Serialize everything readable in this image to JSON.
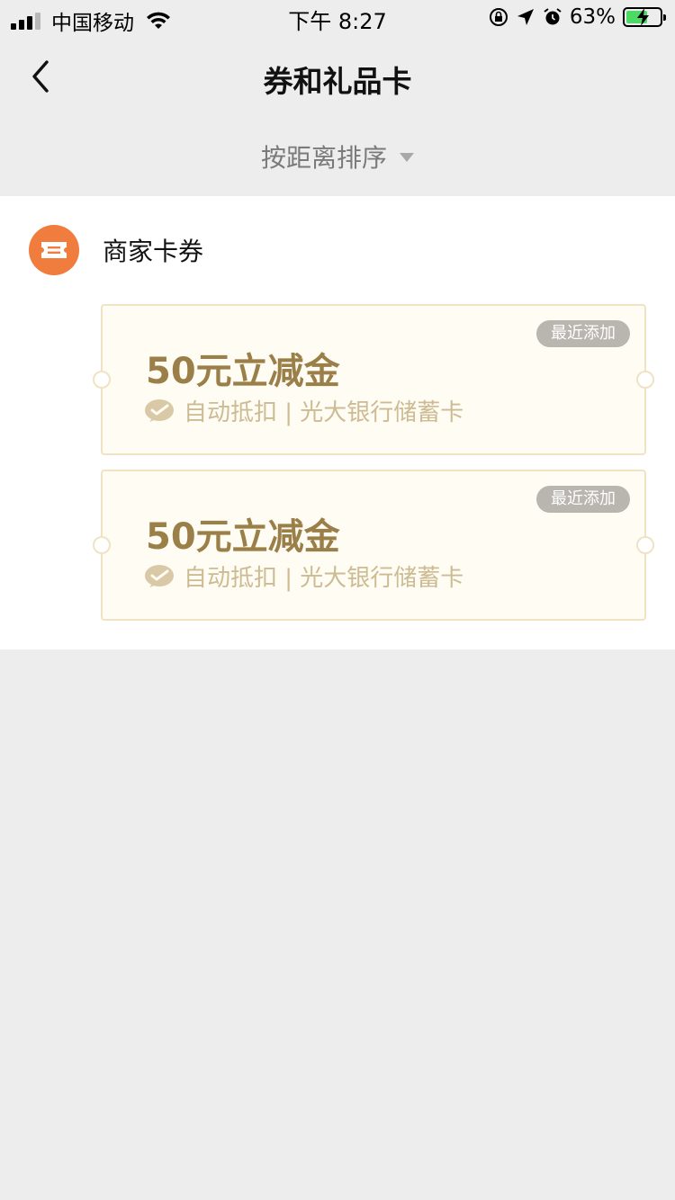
{
  "status_bar": {
    "carrier": "中国移动",
    "time": "下午 8:27",
    "battery_percent": "63%",
    "battery_level": 0.63,
    "icons": [
      "signal-icon",
      "wifi-icon",
      "orientation-lock-icon",
      "location-icon",
      "alarm-icon",
      "battery-icon"
    ]
  },
  "nav": {
    "title": "券和礼品卡",
    "back_icon": "chevron-left-icon"
  },
  "sort": {
    "label": "按距离排序",
    "icon": "triangle-down-icon"
  },
  "section": {
    "title": "商家卡券",
    "icon": "ticket-icon",
    "icon_color": "#f07c3e"
  },
  "coupons": [
    {
      "amount": "50元立减金",
      "description": "自动抵扣 | 光大银行储蓄卡",
      "badge": "最近添加"
    },
    {
      "amount": "50元立减金",
      "description": "自动抵扣 | 光大银行储蓄卡",
      "badge": "最近添加"
    }
  ],
  "colors": {
    "background": "#ededed",
    "coupon_bg": "#fffcf3",
    "coupon_border": "#efe3c4",
    "amount_text": "#9b7f48",
    "desc_text": "#cdbb93",
    "badge_bg": "#b9b6b0"
  }
}
